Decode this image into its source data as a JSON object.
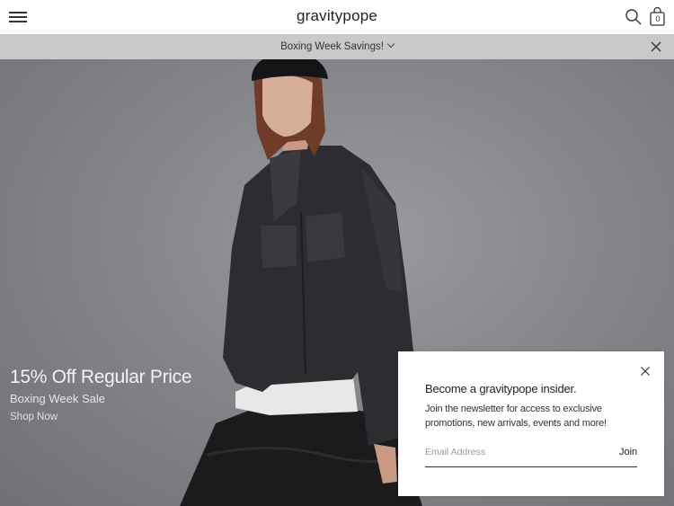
{
  "header": {
    "logo": "gravitypope",
    "menu_icon": "hamburger-menu-icon",
    "search_icon": "search-icon",
    "cart_icon": "shopping-bag-icon",
    "cart_count": "0"
  },
  "promo_bar": {
    "text": "Boxing Week Savings!",
    "chevron_icon": "chevron-down-icon",
    "close_icon": "close-icon"
  },
  "hero": {
    "headline": "15% Off Regular Price",
    "subheadline": "Boxing Week Sale",
    "cta": "Shop Now"
  },
  "newsletter": {
    "title": "Become a gravitypope insider.",
    "body": "Join the newsletter for access to exclusive promotions, new arrivals, events and more!",
    "email_placeholder": "Email Address",
    "join_label": "Join",
    "close_icon": "close-icon"
  },
  "colors": {
    "promo_bar_bg": "#c9c9c9",
    "hero_bg": "#86868a",
    "text_dark": "#222222"
  }
}
